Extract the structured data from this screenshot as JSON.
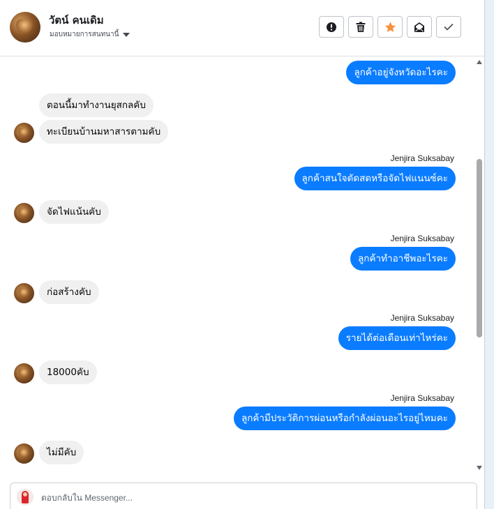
{
  "header": {
    "contact_name": "วัตน์ คนเดิม",
    "assign_label": "มอบหมายการสนทนานี้"
  },
  "actions": [
    {
      "name": "spam-button",
      "icon": "alert-icon"
    },
    {
      "name": "delete-button",
      "icon": "trash-icon"
    },
    {
      "name": "star-button",
      "icon": "star-icon"
    },
    {
      "name": "mark-unread-button",
      "icon": "envelope-icon"
    },
    {
      "name": "done-button",
      "icon": "check-icon"
    }
  ],
  "messages": [
    {
      "dir": "out",
      "text": "ลูกค้าอยู่จังหวัดอะไรคะ"
    },
    {
      "dir": "in",
      "text": "ตอนนี้มาทำงานยุสกลคับ"
    },
    {
      "dir": "in",
      "text": "ทะเบียนบ้านมหาสารตามคับ"
    },
    {
      "dir": "out",
      "sender": "Jenjira Suksabay",
      "text": "ลูกค้าสนใจตัดสดหรือจัดไฟแนนซ์คะ"
    },
    {
      "dir": "in",
      "text": "จัดไฟแน้นคับ"
    },
    {
      "dir": "out",
      "sender": "Jenjira Suksabay",
      "text": "ลูกค้าทำอาชีพอะไรคะ"
    },
    {
      "dir": "in",
      "text": "ก่อสร้างคับ"
    },
    {
      "dir": "out",
      "sender": "Jenjira Suksabay",
      "text": "รายได้ต่อเดือนเท่าไหร่คะ"
    },
    {
      "dir": "in",
      "text": "18000คับ"
    },
    {
      "dir": "out",
      "sender": "Jenjira Suksabay",
      "text": "ลูกค้ามีประวัติการผ่อนหรือกำลังผ่อนอะไรอยู่ไหมคะ"
    },
    {
      "dir": "in",
      "text": "ไม่มีคับ"
    }
  ],
  "composer": {
    "placeholder": "ตอบกลับใน Messenger..."
  },
  "colors": {
    "outgoing_bubble": "#0a7cff",
    "incoming_bubble": "#f0f0f0",
    "star": "#f7923a"
  }
}
